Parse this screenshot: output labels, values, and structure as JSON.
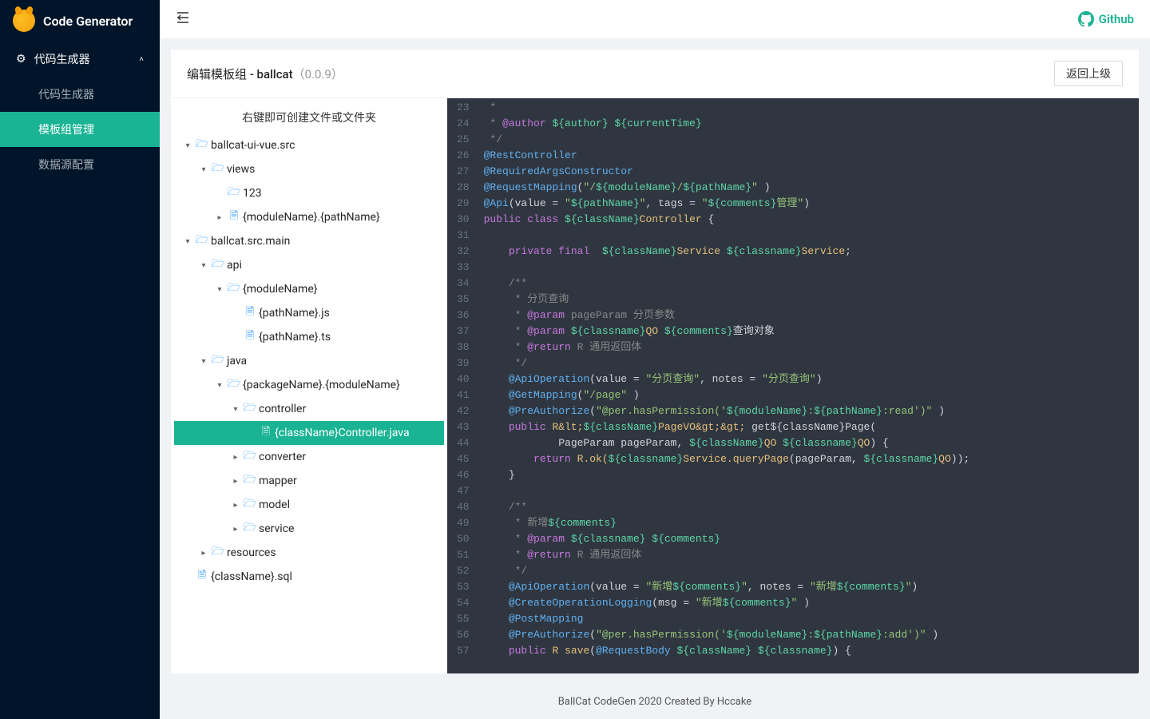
{
  "brand": "Code Generator",
  "sidebar": {
    "group": "代码生成器",
    "items": [
      "代码生成器",
      "模板组管理",
      "数据源配置"
    ],
    "activeIndex": 1
  },
  "topbar": {
    "github": "Github"
  },
  "card": {
    "title_prefix": "编辑模板组 - ballcat",
    "version": "（0.0.9）",
    "back": "返回上级",
    "tree_hint": "右键即可创建文件或文件夹"
  },
  "tree": [
    {
      "d": 0,
      "t": "folder-open",
      "a": "down",
      "label": "ballcat-ui-vue.src"
    },
    {
      "d": 1,
      "t": "folder-open",
      "a": "down",
      "label": "views"
    },
    {
      "d": 2,
      "t": "folder-open",
      "a": "none",
      "label": "123"
    },
    {
      "d": 2,
      "t": "file",
      "a": "right",
      "label": "{moduleName}.{pathName}"
    },
    {
      "d": 0,
      "t": "folder-open",
      "a": "down",
      "label": "ballcat.src.main"
    },
    {
      "d": 1,
      "t": "folder-open",
      "a": "down",
      "label": "api"
    },
    {
      "d": 2,
      "t": "folder-open",
      "a": "down",
      "label": "{moduleName}"
    },
    {
      "d": 3,
      "t": "file",
      "a": "none",
      "label": "{pathName}.js"
    },
    {
      "d": 3,
      "t": "file",
      "a": "none",
      "label": "{pathName}.ts"
    },
    {
      "d": 1,
      "t": "folder-open",
      "a": "down",
      "label": "java"
    },
    {
      "d": 2,
      "t": "folder-open",
      "a": "down",
      "label": "{packageName}.{moduleName}"
    },
    {
      "d": 3,
      "t": "folder-open",
      "a": "down",
      "label": "controller"
    },
    {
      "d": 4,
      "t": "file",
      "a": "none",
      "label": "{className}Controller.java",
      "sel": true
    },
    {
      "d": 3,
      "t": "folder-open",
      "a": "right",
      "label": "converter"
    },
    {
      "d": 3,
      "t": "folder-open",
      "a": "right",
      "label": "mapper"
    },
    {
      "d": 3,
      "t": "folder-open",
      "a": "right",
      "label": "model"
    },
    {
      "d": 3,
      "t": "folder-open",
      "a": "right",
      "label": "service"
    },
    {
      "d": 1,
      "t": "folder-open",
      "a": "right",
      "label": "resources"
    },
    {
      "d": 0,
      "t": "file",
      "a": "none",
      "label": "{className}.sql"
    }
  ],
  "code": {
    "startLine": 23,
    "lines": [
      [
        [
          "tk-c1",
          " *"
        ]
      ],
      [
        [
          "tk-c1",
          " * "
        ],
        [
          "tk-at",
          "@author"
        ],
        [
          "tk-c1",
          " "
        ],
        [
          "tk-var",
          "${author}"
        ],
        [
          "tk-c1",
          " "
        ],
        [
          "tk-var",
          "${currentTime}"
        ]
      ],
      [
        [
          "tk-c1",
          " */"
        ]
      ],
      [
        [
          "tk-ann",
          "@RestController"
        ]
      ],
      [
        [
          "tk-ann",
          "@RequiredArgsConstructor"
        ]
      ],
      [
        [
          "tk-ann",
          "@RequestMapping"
        ],
        [
          "tk-punc",
          "("
        ],
        [
          "tk-str",
          "\"/"
        ],
        [
          "tk-var",
          "${moduleName}"
        ],
        [
          "tk-str",
          "/"
        ],
        [
          "tk-var",
          "${pathName}"
        ],
        [
          "tk-str",
          "\" "
        ],
        [
          "tk-punc",
          ")"
        ]
      ],
      [
        [
          "tk-ann",
          "@Api"
        ],
        [
          "tk-punc",
          "(value = "
        ],
        [
          "tk-str",
          "\""
        ],
        [
          "tk-var",
          "${pathName}"
        ],
        [
          "tk-str",
          "\""
        ],
        [
          "tk-punc",
          ", tags = "
        ],
        [
          "tk-str",
          "\""
        ],
        [
          "tk-var",
          "${comments}"
        ],
        [
          "tk-str",
          "管理\""
        ],
        [
          "tk-punc",
          ")"
        ]
      ],
      [
        [
          "tk-kw",
          "public class "
        ],
        [
          "tk-var",
          "${className}"
        ],
        [
          "tk-id",
          "Controller"
        ],
        [
          "tk-punc",
          " {"
        ]
      ],
      [],
      [
        [
          "tk-punc",
          "    "
        ],
        [
          "tk-kw",
          "private final"
        ],
        [
          "tk-punc",
          "  "
        ],
        [
          "tk-var",
          "${className}"
        ],
        [
          "tk-id",
          "Service "
        ],
        [
          "tk-var",
          "${classname}"
        ],
        [
          "tk-id",
          "Service"
        ],
        [
          "tk-punc",
          ";"
        ]
      ],
      [],
      [
        [
          "tk-c1",
          "    /**"
        ]
      ],
      [
        [
          "tk-c1",
          "     * 分页查询"
        ]
      ],
      [
        [
          "tk-c1",
          "     * "
        ],
        [
          "tk-at",
          "@param"
        ],
        [
          "tk-c1",
          " pageParam 分页参数"
        ]
      ],
      [
        [
          "tk-c1",
          "     * "
        ],
        [
          "tk-at",
          "@param"
        ],
        [
          "tk-c1",
          " "
        ],
        [
          "tk-var",
          "${classname}"
        ],
        [
          "tk-id",
          "QO "
        ],
        [
          "tk-var",
          "${comments}"
        ],
        [
          "tk-white",
          "查询对象"
        ]
      ],
      [
        [
          "tk-c1",
          "     * "
        ],
        [
          "tk-at",
          "@return"
        ],
        [
          "tk-c1",
          " R 通用返回体"
        ]
      ],
      [
        [
          "tk-c1",
          "     */"
        ]
      ],
      [
        [
          "tk-punc",
          "    "
        ],
        [
          "tk-ann",
          "@ApiOperation"
        ],
        [
          "tk-punc",
          "(value = "
        ],
        [
          "tk-str",
          "\"分页查询\""
        ],
        [
          "tk-punc",
          ", notes = "
        ],
        [
          "tk-str",
          "\"分页查询\""
        ],
        [
          "tk-punc",
          ")"
        ]
      ],
      [
        [
          "tk-punc",
          "    "
        ],
        [
          "tk-ann",
          "@GetMapping"
        ],
        [
          "tk-punc",
          "("
        ],
        [
          "tk-str",
          "\"/page\" "
        ],
        [
          "tk-punc",
          ")"
        ]
      ],
      [
        [
          "tk-punc",
          "    "
        ],
        [
          "tk-ann",
          "@PreAuthorize"
        ],
        [
          "tk-punc",
          "("
        ],
        [
          "tk-str",
          "\"@per.hasPermission('"
        ],
        [
          "tk-var",
          "${moduleName}"
        ],
        [
          "tk-str",
          ":"
        ],
        [
          "tk-var",
          "${pathName}"
        ],
        [
          "tk-str",
          ":read')\" "
        ],
        [
          "tk-punc",
          ")"
        ]
      ],
      [
        [
          "tk-punc",
          "    "
        ],
        [
          "tk-kw",
          "public "
        ],
        [
          "tk-id",
          "R&lt;"
        ],
        [
          "tk-var",
          "${className}"
        ],
        [
          "tk-id",
          "PageVO&gt;&gt;"
        ],
        [
          "tk-punc",
          " get${className}Page("
        ]
      ],
      [
        [
          "tk-punc",
          "            PageParam pageParam, "
        ],
        [
          "tk-var",
          "${className}"
        ],
        [
          "tk-id",
          "QO "
        ],
        [
          "tk-var",
          "${classname}"
        ],
        [
          "tk-id",
          "QO"
        ],
        [
          "tk-punc",
          ") {"
        ]
      ],
      [
        [
          "tk-punc",
          "        "
        ],
        [
          "tk-kw",
          "return "
        ],
        [
          "tk-id",
          "R.ok("
        ],
        [
          "tk-var",
          "${classname}"
        ],
        [
          "tk-id",
          "Service.queryPage"
        ],
        [
          "tk-punc",
          "(pageParam, "
        ],
        [
          "tk-var",
          "${classname}"
        ],
        [
          "tk-id",
          "QO"
        ],
        [
          "tk-punc",
          "));"
        ]
      ],
      [
        [
          "tk-punc",
          "    }"
        ]
      ],
      [],
      [
        [
          "tk-c1",
          "    /**"
        ]
      ],
      [
        [
          "tk-c1",
          "     * 新增"
        ],
        [
          "tk-var",
          "${comments}"
        ]
      ],
      [
        [
          "tk-c1",
          "     * "
        ],
        [
          "tk-at",
          "@param"
        ],
        [
          "tk-c1",
          " "
        ],
        [
          "tk-var",
          "${classname}"
        ],
        [
          "tk-c1",
          " "
        ],
        [
          "tk-var",
          "${comments}"
        ]
      ],
      [
        [
          "tk-c1",
          "     * "
        ],
        [
          "tk-at",
          "@return"
        ],
        [
          "tk-c1",
          " R 通用返回体"
        ]
      ],
      [
        [
          "tk-c1",
          "     */"
        ]
      ],
      [
        [
          "tk-punc",
          "    "
        ],
        [
          "tk-ann",
          "@ApiOperation"
        ],
        [
          "tk-punc",
          "(value = "
        ],
        [
          "tk-str",
          "\"新增"
        ],
        [
          "tk-var",
          "${comments}"
        ],
        [
          "tk-str",
          "\""
        ],
        [
          "tk-punc",
          ", notes = "
        ],
        [
          "tk-str",
          "\"新增"
        ],
        [
          "tk-var",
          "${comments}"
        ],
        [
          "tk-str",
          "\""
        ],
        [
          "tk-punc",
          ")"
        ]
      ],
      [
        [
          "tk-punc",
          "    "
        ],
        [
          "tk-ann",
          "@CreateOperationLogging"
        ],
        [
          "tk-punc",
          "(msg = "
        ],
        [
          "tk-str",
          "\"新增"
        ],
        [
          "tk-var",
          "${comments}"
        ],
        [
          "tk-str",
          "\" "
        ],
        [
          "tk-punc",
          ")"
        ]
      ],
      [
        [
          "tk-punc",
          "    "
        ],
        [
          "tk-ann",
          "@PostMapping"
        ]
      ],
      [
        [
          "tk-punc",
          "    "
        ],
        [
          "tk-ann",
          "@PreAuthorize"
        ],
        [
          "tk-punc",
          "("
        ],
        [
          "tk-str",
          "\"@per.hasPermission('"
        ],
        [
          "tk-var",
          "${moduleName}"
        ],
        [
          "tk-str",
          ":"
        ],
        [
          "tk-var",
          "${pathName}"
        ],
        [
          "tk-str",
          ":add')\" "
        ],
        [
          "tk-punc",
          ")"
        ]
      ],
      [
        [
          "tk-punc",
          "    "
        ],
        [
          "tk-kw",
          "public "
        ],
        [
          "tk-id",
          "R save"
        ],
        [
          "tk-punc",
          "("
        ],
        [
          "tk-ann",
          "@RequestBody "
        ],
        [
          "tk-var",
          "${className}"
        ],
        [
          "tk-punc",
          " "
        ],
        [
          "tk-var",
          "${classname}"
        ],
        [
          "tk-punc",
          ") {"
        ]
      ]
    ]
  },
  "footer": "BallCat CodeGen 2020 Created By Hccake"
}
